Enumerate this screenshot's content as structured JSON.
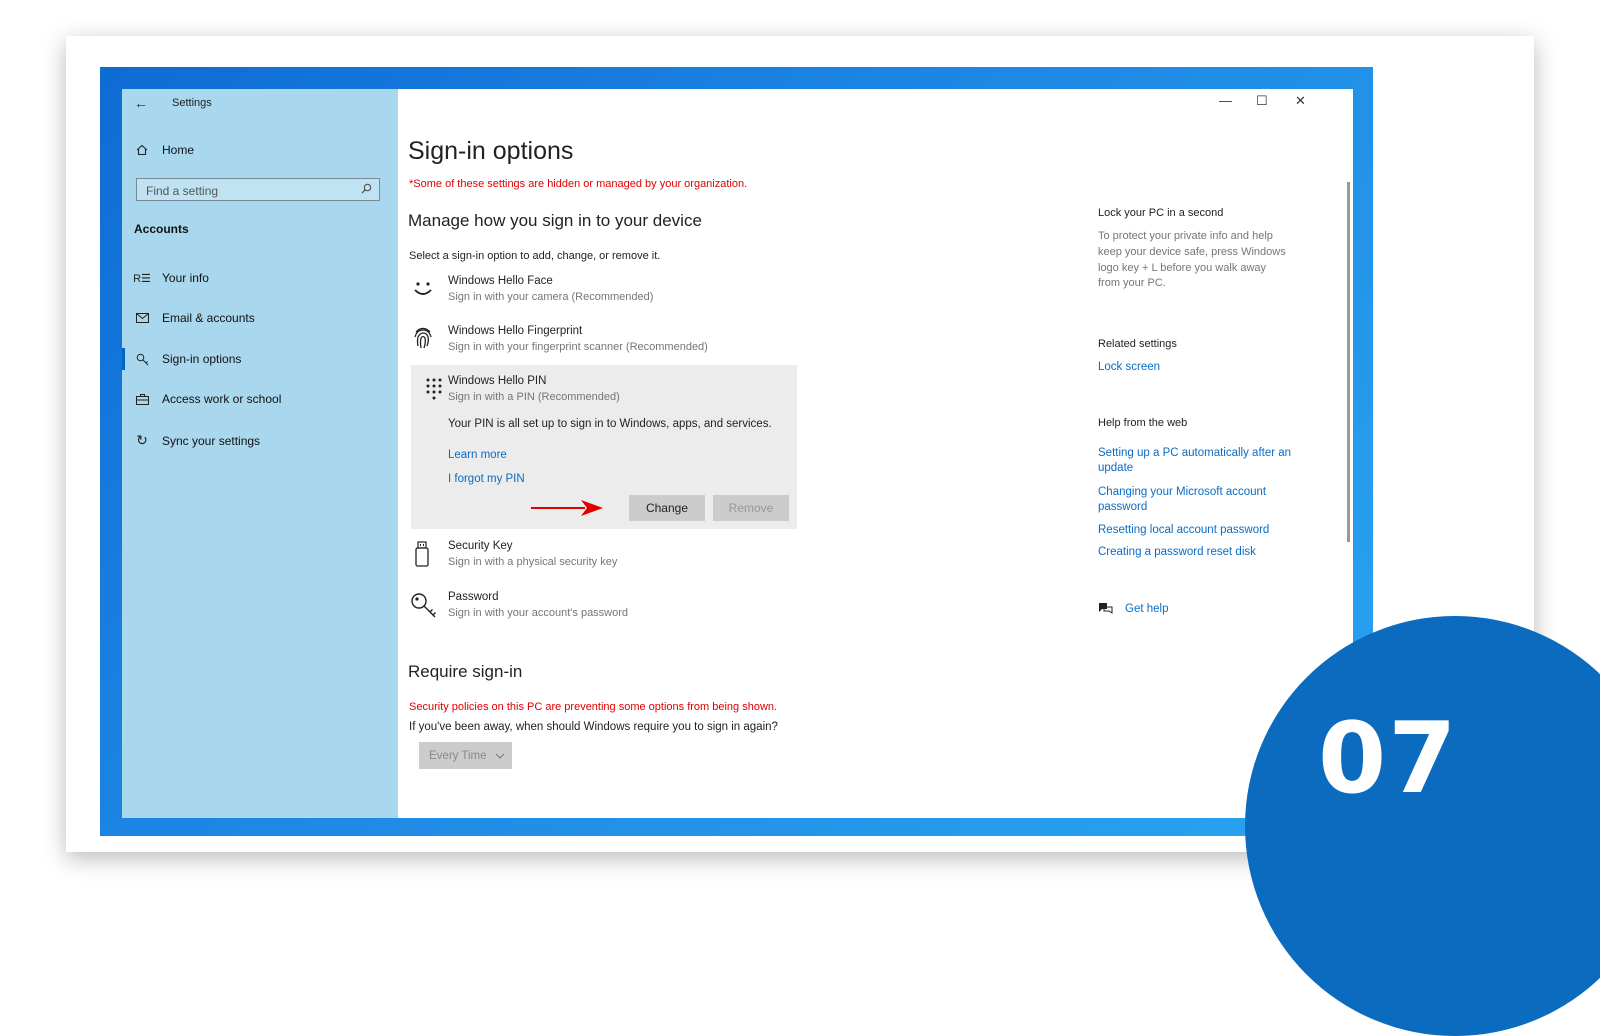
{
  "window": {
    "title": "Settings",
    "back_icon": "←",
    "minimize": "—",
    "maximize": "☐",
    "close": "✕"
  },
  "sidebar": {
    "home": "Home",
    "search_placeholder": "Find a setting",
    "section": "Accounts",
    "items": [
      {
        "label": "Your info",
        "icon": "person-list-icon"
      },
      {
        "label": "Email & accounts",
        "icon": "mail-icon"
      },
      {
        "label": "Sign-in options",
        "icon": "key-icon",
        "selected": true
      },
      {
        "label": "Access work or school",
        "icon": "briefcase-icon"
      },
      {
        "label": "Sync your settings",
        "icon": "sync-icon"
      }
    ]
  },
  "main": {
    "title": "Sign-in options",
    "org_notice": "*Some of these settings are hidden or managed by your organization.",
    "manage_heading": "Manage how you sign in to your device",
    "select_hint": "Select a sign-in option to add, change, or remove it.",
    "options": [
      {
        "title": "Windows Hello Face",
        "sub": "Sign in with your camera (Recommended)",
        "icon": "face-icon"
      },
      {
        "title": "Windows Hello Fingerprint",
        "sub": "Sign in with your fingerprint scanner (Recommended)",
        "icon": "fingerprint-icon"
      },
      {
        "title": "Windows Hello PIN",
        "sub": "Sign in with a PIN (Recommended)",
        "icon": "pin-keypad-icon"
      },
      {
        "title": "Security Key",
        "sub": "Sign in with a physical security key",
        "icon": "usb-key-icon"
      },
      {
        "title": "Password",
        "sub": "Sign in with your account's password",
        "icon": "password-key-icon"
      }
    ],
    "pin_status": "Your PIN is all set up to sign in to Windows, apps, and services.",
    "learn_more": "Learn more",
    "forgot_pin": "I forgot my PIN",
    "change_button": "Change",
    "remove_button": "Remove",
    "require_heading": "Require sign-in",
    "policy_notice": "Security policies on this PC are preventing some options from being shown.",
    "require_question": "If you've been away, when should Windows require you to sign in again?",
    "require_value": "Every Time"
  },
  "right_panel": {
    "lock_title": "Lock your PC in a second",
    "lock_text": [
      "To protect your private info and help",
      "keep your device safe, press Windows",
      "logo key + L before you walk away",
      "from your PC."
    ],
    "related_title": "Related settings",
    "lock_screen_link": "Lock screen",
    "help_title": "Help from the web",
    "links": [
      [
        "Setting up a PC automatically after an",
        "update"
      ],
      [
        "Changing your Microsoft account",
        "password"
      ],
      [
        "Resetting local account password"
      ],
      [
        "Creating a password reset disk"
      ]
    ],
    "get_help": "Get help"
  },
  "badge": {
    "text": "07",
    "color": "#0a6bbf"
  },
  "colors": {
    "sidebar": "#a9d8ee",
    "accent": "#0a6cc4",
    "warning": "#e00000",
    "arrow": "#e00000"
  }
}
